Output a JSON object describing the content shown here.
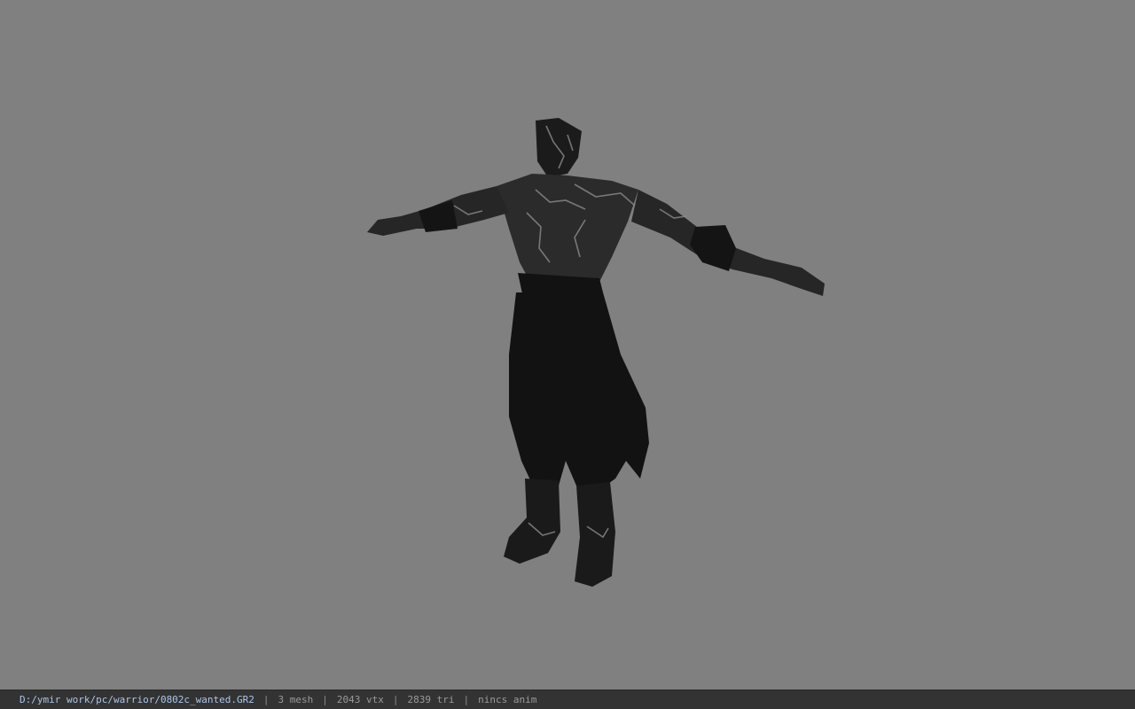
{
  "status_bar": {
    "file_path": "D:/ymir work/pc/warrior/0802c_wanted.GR2",
    "separator": "|",
    "mesh_count": "3 mesh",
    "vertex_count": "2043 vtx",
    "triangle_count": "2839 tri",
    "animation": "nincs anim"
  },
  "colors": {
    "viewport_background": "#808080",
    "status_bar_background": "#333333",
    "path_text": "#a9c6e8",
    "stat_text": "#9a9a9a"
  },
  "viewport": {
    "model_icon": "warrior-character-model"
  }
}
